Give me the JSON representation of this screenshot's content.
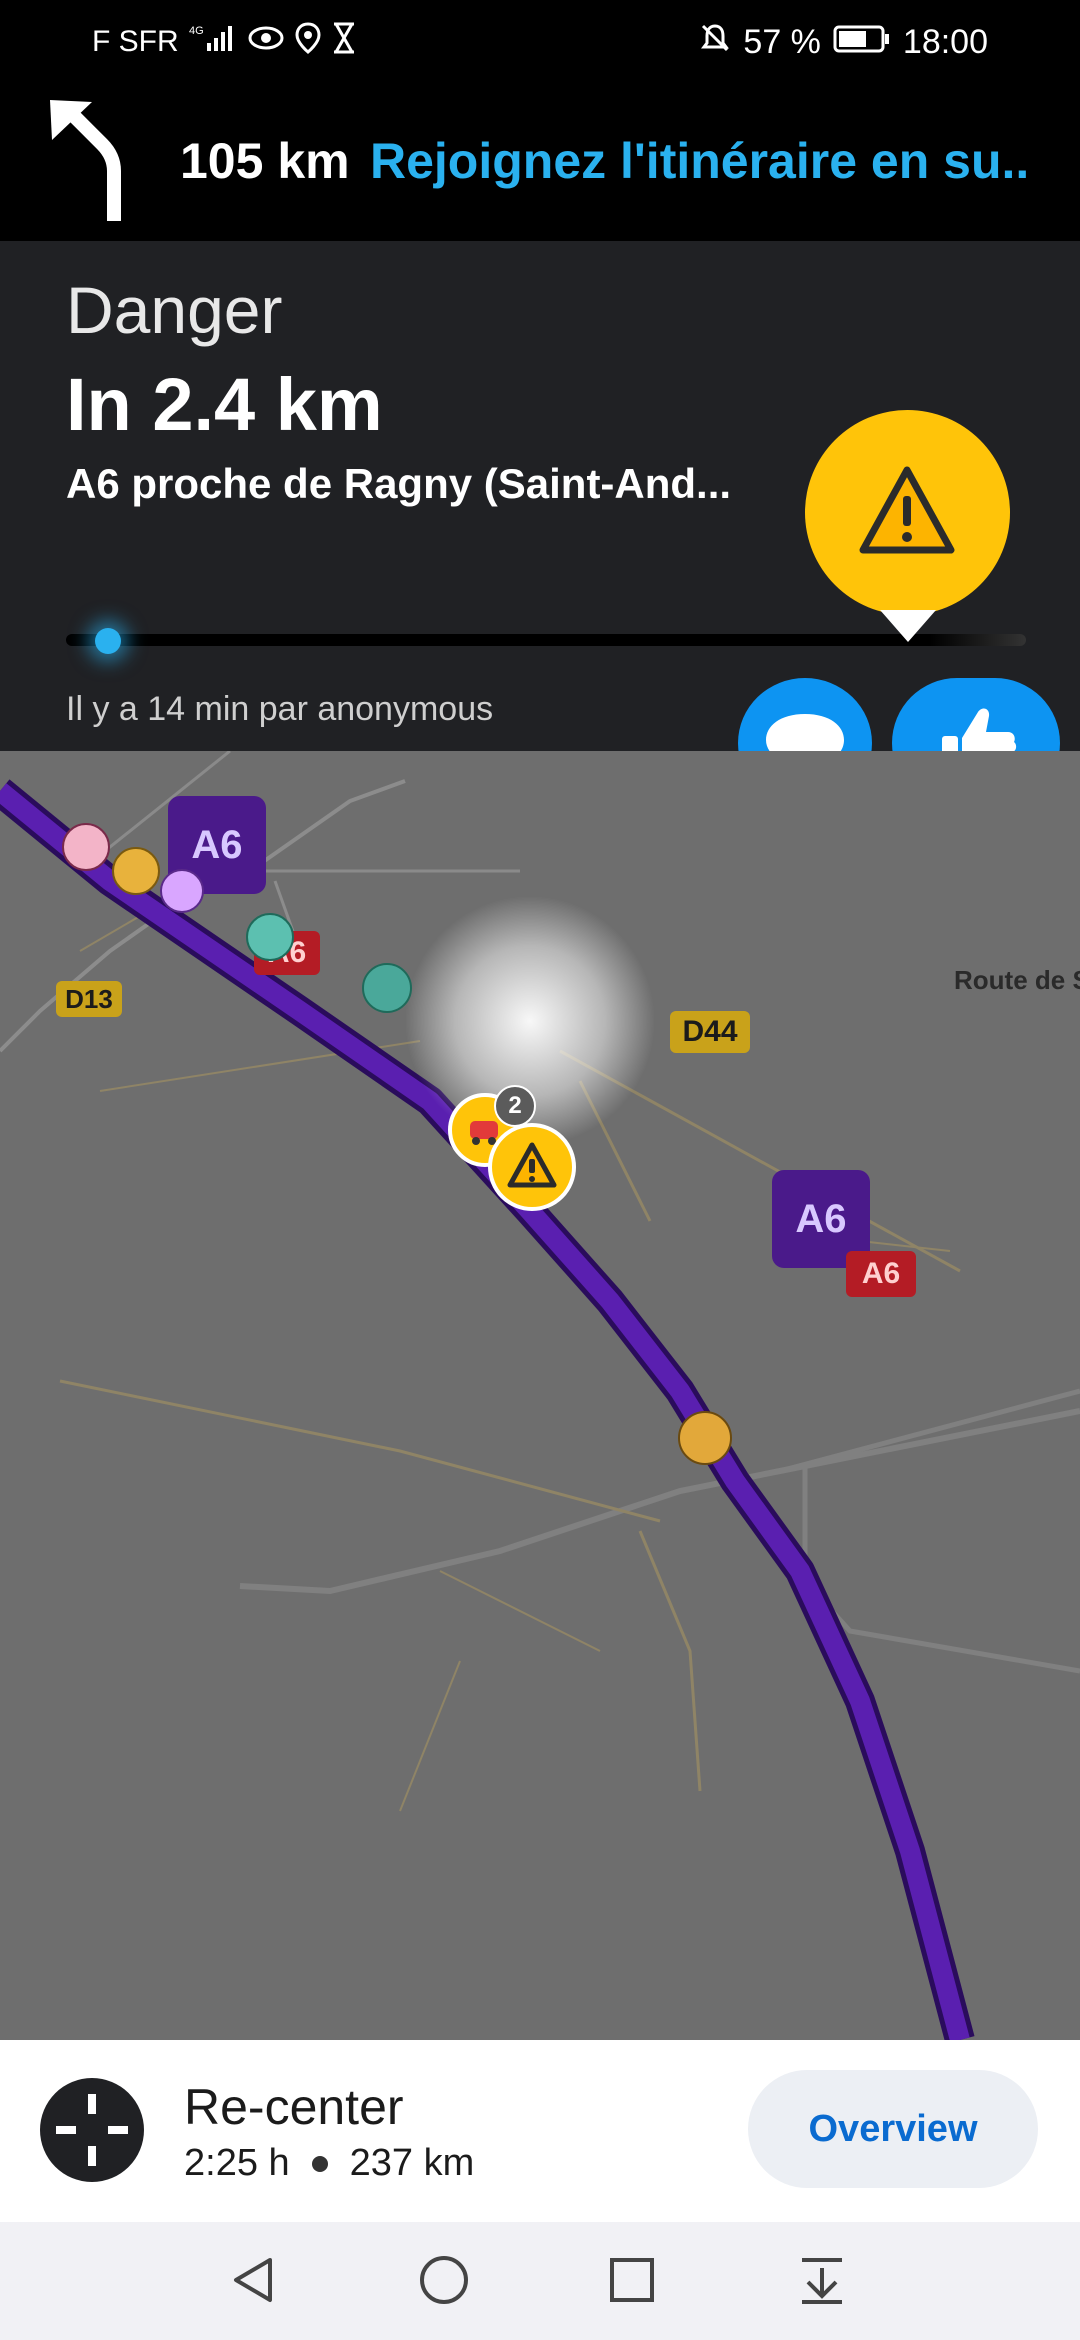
{
  "status_bar": {
    "carrier": "F SFR",
    "network": "4G",
    "battery": "57 %",
    "time": "18:00",
    "icons": [
      "signal-icon",
      "eye-icon",
      "location-icon",
      "hourglass-icon",
      "mute-icon",
      "battery-icon"
    ]
  },
  "nav": {
    "distance": "105 km",
    "instruction": "Rejoignez l'itinéraire en su...",
    "turn_icon": "turn-left-arrow-icon"
  },
  "alert": {
    "type": "Danger",
    "distance": "In 2.4 km",
    "location": "A6 proche de Ragny (Saint-And...",
    "meta": "Il y a 14 min par anonymous",
    "hazard_icon": "warning-icon",
    "progress": 0.03
  },
  "actions": {
    "comment_icon": "comment-bubble-icon",
    "thanks_icon": "thumbs-up-icon"
  },
  "map": {
    "shields": {
      "a6_big_1": "A6",
      "a6_big_2": "A6",
      "a6_red_1": "A6",
      "a6_red_2": "A6",
      "d13": "D13",
      "d44": "D44"
    },
    "road_label": "Route de S",
    "cluster_count": "2"
  },
  "bottom": {
    "recenter": "Re-center",
    "eta": "2:25 h",
    "distance": "237 km",
    "overview": "Overview"
  },
  "colors": {
    "route": "#4a1a8a",
    "alert_yellow": "#ffc409",
    "action_blue": "#0d94f2",
    "instruction_blue": "#2ab1ef"
  }
}
